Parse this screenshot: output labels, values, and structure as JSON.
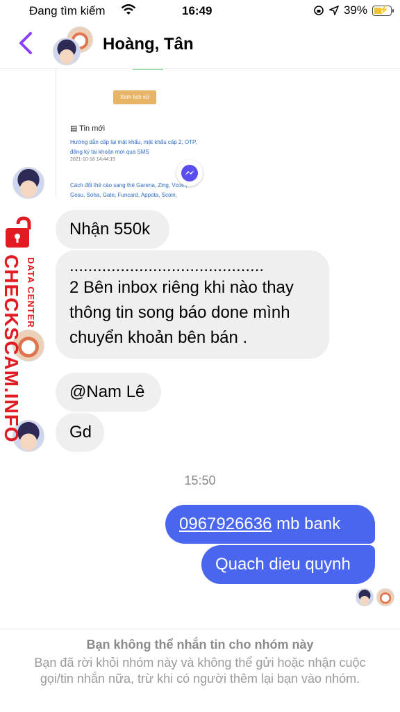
{
  "status_bar": {
    "carrier": "Đang tìm kiếm",
    "time": "16:49",
    "battery": "39%"
  },
  "header": {
    "title": "Hoàng, Tân"
  },
  "screenshot": {
    "button": "Xem lịch sử",
    "section": "Tin mới",
    "link1": "Hướng dẫn cấp lại mật khẩu, mật khẩu cấp 2, OTP, đăng ký tài khoản mới qua SMS",
    "date": "2021-10-16 14:44:15",
    "link2": "Cách đổi thẻ cào sang thẻ Garena, Zing, Vcoin, Gosu, Soha, Gate, Funcard, Appota, Scoin,"
  },
  "messages": {
    "m1": "Nhận 550k",
    "m2_dots": "..........................................",
    "m2_text": "2 Bên inbox riêng khi nào thay thông tin song báo done mình chuyển khoản bên bán .",
    "m3": "@Nam Lê",
    "m4": "Gd",
    "time_sep": "15:50",
    "s1_number": "0967926636",
    "s1_rest": " mb bank",
    "s2": "Quach dieu quynh"
  },
  "footer": {
    "title": "Bạn không thể nhắn tin cho nhóm này",
    "body": "Bạn đã rời khỏi nhóm này và không thể gửi hoặc nhận cuộc gọi/tin nhắn nữa, trừ khi có người thêm lại bạn vào nhóm."
  },
  "watermark": {
    "main": "CHECKSCAM.INFO",
    "sub": "DATA CENTER"
  },
  "colors": {
    "accent": "#4a66ee",
    "back": "#8a3ffc",
    "watermark": "#e21b23"
  }
}
